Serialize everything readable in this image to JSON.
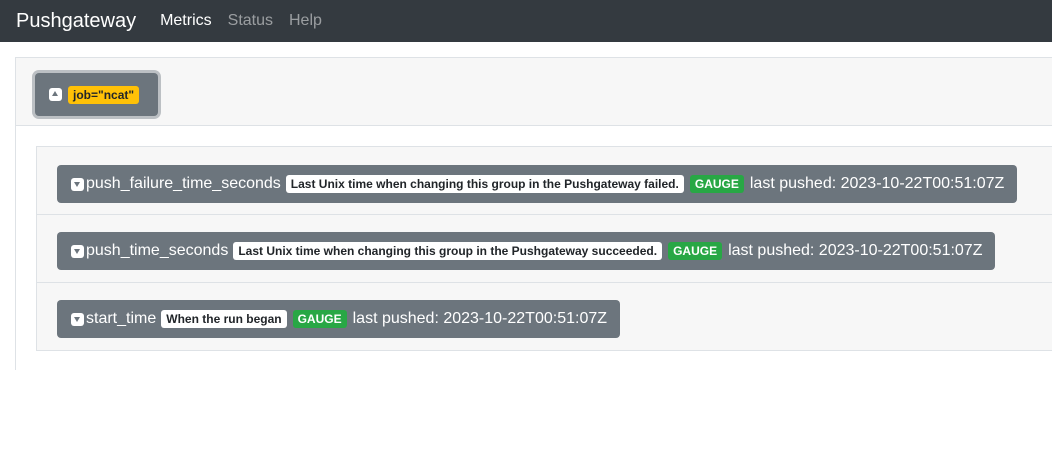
{
  "navbar": {
    "brand": "Pushgateway",
    "links": [
      "Metrics",
      "Status",
      "Help"
    ]
  },
  "group": {
    "label": "job=\"ncat\"",
    "toggle_icon": "collapse-up-icon"
  },
  "metrics": [
    {
      "name": "push_failure_time_seconds",
      "help": "Last Unix time when changing this group in the Pushgateway failed.",
      "type": "GAUGE",
      "last_pushed": "last pushed: 2023-10-22T00:51:07Z"
    },
    {
      "name": "push_time_seconds",
      "help": "Last Unix time when changing this group in the Pushgateway succeeded.",
      "type": "GAUGE",
      "last_pushed": "last pushed: 2023-10-22T00:51:07Z"
    },
    {
      "name": "start_time",
      "help": "When the run began",
      "type": "GAUGE",
      "last_pushed": "last pushed: 2023-10-22T00:51:07Z"
    }
  ],
  "colors": {
    "navbar": "#343a40",
    "button": "#6c757d",
    "label_badge": "#ffc107",
    "gauge_badge": "#28a745"
  }
}
